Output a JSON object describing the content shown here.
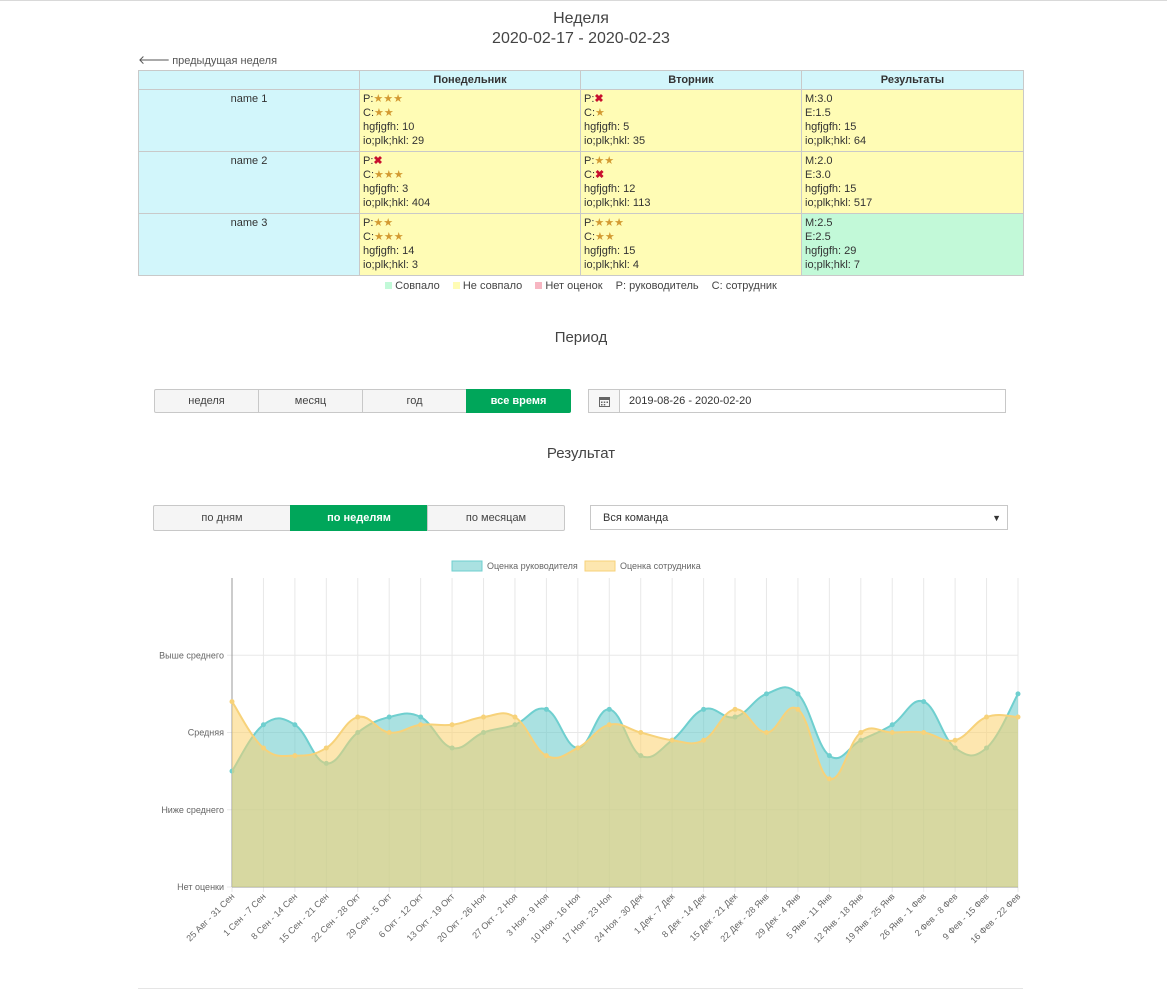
{
  "header": {
    "title": "Неделя",
    "range": "2020-02-17 - 2020-02-23",
    "prev_link": "предыдущая неделя"
  },
  "table": {
    "columns": [
      "",
      "Понедельник",
      "Вторник",
      "Результаты"
    ],
    "rows": [
      {
        "name": "name 1",
        "mon": {
          "p": "P:",
          "p_stars": 3,
          "c": "C:",
          "c_stars": 2,
          "l1": "hgfjgfh: 10",
          "l2": "io;plk;hkl: 29"
        },
        "tue": {
          "p": "P:",
          "p_stars": 0,
          "c": "C:",
          "c_stars": 1,
          "l1": "hgfjgfh: 5",
          "l2": "io;plk;hkl: 35"
        },
        "res": {
          "m": "M:3.0",
          "e": "E:1.5",
          "l1": "hgfjgfh: 15",
          "l2": "io;plk;hkl: 64",
          "status": "Не совпало"
        }
      },
      {
        "name": "name 2",
        "mon": {
          "p": "P:",
          "p_stars": 0,
          "c": "C:",
          "c_stars": 3,
          "l1": "hgfjgfh: 3",
          "l2": "io;plk;hkl: 404"
        },
        "tue": {
          "p": "P:",
          "p_stars": 2,
          "c": "C:",
          "c_stars": 0,
          "l1": "hgfjgfh: 12",
          "l2": "io;plk;hkl: 113"
        },
        "res": {
          "m": "M:2.0",
          "e": "E:3.0",
          "l1": "hgfjgfh: 15",
          "l2": "io;plk;hkl: 517",
          "status": "Не совпало"
        }
      },
      {
        "name": "name 3",
        "mon": {
          "p": "P:",
          "p_stars": 2,
          "c": "C:",
          "c_stars": 3,
          "l1": "hgfjgfh: 14",
          "l2": "io;plk;hkl: 3"
        },
        "tue": {
          "p": "P:",
          "p_stars": 3,
          "c": "C:",
          "c_stars": 2,
          "l1": "hgfjgfh: 15",
          "l2": "io;plk;hkl: 4"
        },
        "res": {
          "m": "M:2.5",
          "e": "E:2.5",
          "l1": "hgfjgfh: 29",
          "l2": "io;plk;hkl: 7",
          "status": "Совпало"
        }
      }
    ]
  },
  "legend": {
    "match": "Совпало",
    "nomatch": "Не совпало",
    "none": "Нет оценок",
    "p": "P: руководитель",
    "c": "C: сотрудник"
  },
  "colors": {
    "match": "#c2f9d8",
    "nomatch": "#fffcb5",
    "none": "#f7b6c2",
    "accent": "#00a65a",
    "series_manager": "#6fcfcf",
    "series_employee": "#f7d27a",
    "overlap": "#a4cfa8"
  },
  "period": {
    "title": "Период",
    "buttons": [
      "неделя",
      "месяц",
      "год",
      "все время"
    ],
    "active": "все время",
    "date_range": "2019-08-26 - 2020-02-20",
    "date_icon": "calendar-icon"
  },
  "result": {
    "title": "Результат",
    "buttons": [
      "по дням",
      "по неделям",
      "по месяцам"
    ],
    "active": "по неделям",
    "team_select": "Вся команда"
  },
  "chart_data": {
    "type": "area",
    "legend": [
      "Оценка руководителя",
      "Оценка сотрудника"
    ],
    "y_tick_labels": [
      "Нет оценки",
      "Ниже среднего",
      "Средняя",
      "Выше среднего"
    ],
    "y_ticks": [
      0,
      1,
      2,
      3
    ],
    "ylim": [
      0,
      4
    ],
    "x": [
      "25 Авг - 31 Сен",
      "1 Сен - 7 Сен",
      "8 Сен - 14 Сен",
      "15 Сен - 21 Сен",
      "22 Сен - 28 Окт",
      "29 Сен - 5 Окт",
      "6 Окт - 12 Окт",
      "13 Окт - 19 Окт",
      "20 Окт - 26 Ноя",
      "27 Окт - 2 Ноя",
      "3 Ноя - 9 Ноя",
      "10 Ноя - 16 Ноя",
      "17 Ноя - 23 Ноя",
      "24 Ноя - 30 Дек",
      "1 Дек - 7 Дек",
      "8 Дек - 14 Дек",
      "15 Дек - 21 Дек",
      "22 Дек - 28 Янв",
      "29 Дек - 4 Янв",
      "5 Янв - 11 Янв",
      "12 Янв - 18 Янв",
      "19 Янв - 25 Янв",
      "26 Янв - 1 Фев",
      "2 Фев - 8 Фев",
      "9 Фев - 15 Фев",
      "16 Фев - 22 Фев"
    ],
    "series": [
      {
        "name": "Оценка руководителя",
        "values": [
          1.5,
          2.1,
          2.1,
          1.6,
          2.0,
          2.2,
          2.2,
          1.8,
          2.0,
          2.1,
          2.3,
          1.8,
          2.3,
          1.7,
          1.9,
          2.3,
          2.2,
          2.5,
          2.5,
          1.7,
          1.9,
          2.1,
          2.4,
          1.8,
          1.8,
          2.5
        ]
      },
      {
        "name": "Оценка сотрудника",
        "values": [
          2.4,
          1.8,
          1.7,
          1.8,
          2.2,
          2.0,
          2.1,
          2.1,
          2.2,
          2.2,
          1.7,
          1.8,
          2.1,
          2.0,
          1.9,
          1.9,
          2.3,
          2.0,
          2.3,
          1.4,
          2.0,
          2.0,
          2.0,
          1.9,
          2.2,
          2.2
        ]
      }
    ]
  }
}
